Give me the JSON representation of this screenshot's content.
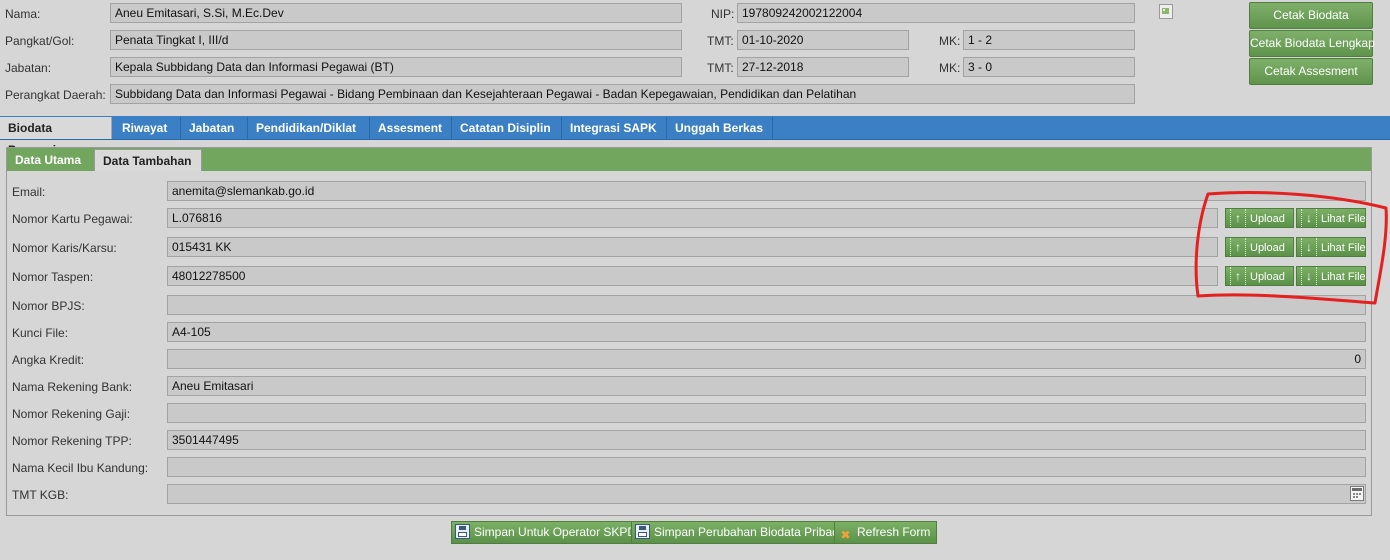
{
  "header": {
    "nama_label": "Nama:",
    "nama_value": "Aneu Emitasari, S.Si, M.Ec.Dev",
    "nip_label": "NIP:",
    "nip_value": "197809242002122004",
    "pangkat_label": "Pangkat/Gol:",
    "pangkat_value": "Penata Tingkat I, III/d",
    "tmt1_label": "TMT:",
    "tmt1_value": "01-10-2020",
    "mk1_label": "MK:",
    "mk1_value": "1 - 2",
    "jabatan_label": "Jabatan:",
    "jabatan_value": "Kepala Subbidang Data dan Informasi Pegawai (BT)",
    "tmt2_label": "TMT:",
    "tmt2_value": "27-12-2018",
    "mk2_label": "MK:",
    "mk2_value": "3 - 0",
    "perangkat_label": "Perangkat Daerah:",
    "perangkat_value": "Subbidang Data dan Informasi Pegawai - Bidang Pembinaan dan Kesejahteraan Pegawai - Badan Kepegawaian, Pendidikan dan Pelatihan"
  },
  "print_buttons": {
    "cetak_biodata": "Cetak Biodata",
    "cetak_lengkap": "Cetak Biodata Lengkap",
    "cetak_assesment": "Cetak Assesment"
  },
  "tabs": [
    "Biodata Pegawai",
    "Riwayat",
    "Jabatan",
    "Pendidikan/Diklat",
    "Assesment",
    "Catatan Disiplin",
    "Integrasi SAPK",
    "Unggah Berkas"
  ],
  "subtabs": [
    "Data Utama",
    "Data Tambahan"
  ],
  "form": {
    "email": {
      "label": "Email:",
      "value": "anemita@slemankab.go.id"
    },
    "kartu_pegawai": {
      "label": "Nomor Kartu Pegawai:",
      "value": "L.076816"
    },
    "karis_karsu": {
      "label": "Nomor Karis/Karsu:",
      "value": "015431 KK"
    },
    "taspen": {
      "label": "Nomor Taspen:",
      "value": "48012278500"
    },
    "bpjs": {
      "label": "Nomor BPJS:",
      "value": ""
    },
    "kunci_file": {
      "label": "Kunci File:",
      "value": "A4-105"
    },
    "angka_kredit": {
      "label": "Angka Kredit:",
      "value": "0"
    },
    "rekening_bank": {
      "label": "Nama Rekening Bank:",
      "value": "Aneu Emitasari"
    },
    "rekening_gaji": {
      "label": "Nomor Rekening Gaji:",
      "value": ""
    },
    "rekening_tpp": {
      "label": "Nomor Rekening TPP:",
      "value": "3501447495"
    },
    "ibu_kandung": {
      "label": "Nama Kecil Ibu Kandung:",
      "value": ""
    },
    "tmt_kgb": {
      "label": "TMT KGB:",
      "value": ""
    }
  },
  "file_buttons": {
    "upload": "Upload",
    "lihat": "Lihat File"
  },
  "icons": {
    "upload": "arrow-up-icon",
    "lihat": "arrow-down-icon",
    "save": "floppy-disk-icon",
    "refresh": "x-icon",
    "date": "calendar-icon"
  },
  "footer": {
    "simpan_operator": "Simpan Untuk Operator SKPD",
    "simpan_pribadi": "Simpan Perubahan Biodata Pribadi",
    "refresh": "Refresh Form"
  },
  "colors": {
    "tab_blue": "#3b7fc4",
    "green": "#72a55e",
    "annotation_red": "#e52020"
  }
}
